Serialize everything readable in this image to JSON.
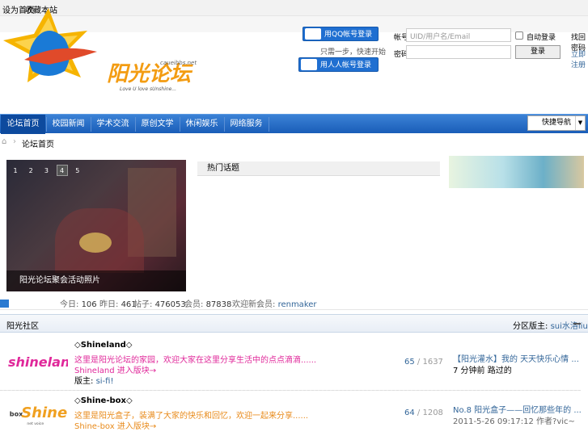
{
  "topbar": {
    "link1": "设为首页",
    "link2": "收藏本站"
  },
  "header": {
    "logo_text": "阳光论坛",
    "logo_slogan": "Love U love sUnshine...",
    "logo_domain": "caueibbs.net",
    "qq_login": "用QQ帐号登录",
    "quick_text": "只需一步，快速开始",
    "renren_login": "用人人帐号登录",
    "account_label": "帐号",
    "account_placeholder": "UID/用户名/Email",
    "auto_login": "自动登录",
    "password_label": "密码",
    "login_button": "登录",
    "retrieve": "找回密码",
    "register": "立即注册"
  },
  "nav": {
    "items": [
      "论坛首页",
      "校园新闻",
      "学术交流",
      "原创文学",
      "休闲娱乐",
      "网络服务"
    ],
    "select": "快捷导航"
  },
  "breadcrumb": {
    "current": "论坛首页"
  },
  "slider": {
    "dots": [
      "1",
      "2",
      "3",
      "4",
      "5"
    ],
    "active_dot": 4,
    "caption": "阳光论坛聚会活动照片"
  },
  "hot": {
    "title": "热门话题"
  },
  "stats": {
    "today_label": "今日:",
    "today": "106",
    "yesterday_label": "昨日:",
    "yesterday": "461",
    "posts_label": "帖子:",
    "posts": "476053",
    "members_label": "会员:",
    "members": "87838",
    "newest_label": "欢迎新会员:",
    "newest": "renmaker"
  },
  "section": {
    "title": "阳光社区",
    "moderator_label": "分区版主:",
    "moderator": "sui水洛liu"
  },
  "forums": [
    {
      "name": "◇Shineland◇",
      "desc": "这里是阳光论坛的家园，欢迎大家在这里分享生活中的点点滴滴......",
      "sub": "Shineland",
      "sub_link": "进入版块→",
      "mods_label": "版主:",
      "mods": "si-fi!",
      "topics": "65",
      "posts": "1637",
      "last1": "【阳光灌水】我的 天天快乐心情 ...",
      "last2": "7 分钟前 路过的"
    },
    {
      "name": "◇Shine-box◇",
      "desc": "这里是阳光盒子，装满了大家的快乐和回忆，欢迎一起来分享......",
      "sub": "Shine-box",
      "sub_link": "进入版块→",
      "topics": "64",
      "posts": "1208",
      "last1": "No.8 阳光盒子——回忆那些年的 ...",
      "last2": "2011-5-26 09:17:12 作者?vic~"
    }
  ],
  "colors": {
    "nav": "#1a5db8",
    "link": "#336699",
    "forum_desc": "#e0289a",
    "forum2_desc": "#e88a1a"
  }
}
